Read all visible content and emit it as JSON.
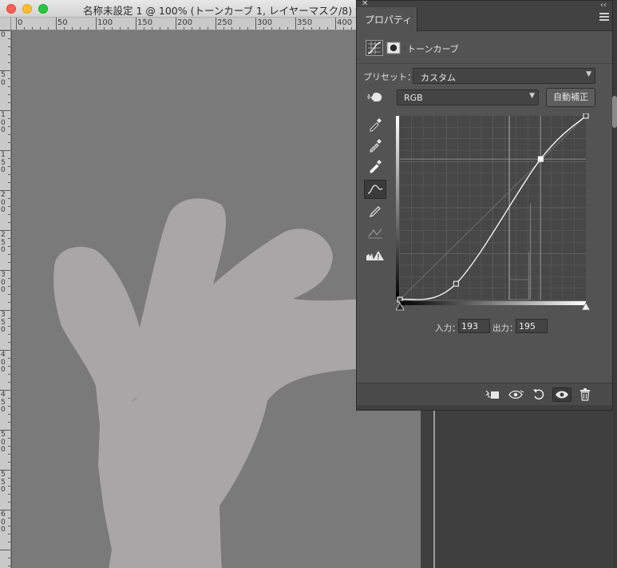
{
  "document": {
    "title": "名称未設定 1 @ 100% (トーンカーブ 1, レイヤーマスク/8) *",
    "ruler_h_labels": [
      "0",
      "50",
      "100",
      "150",
      "200",
      "250",
      "300",
      "350",
      "400"
    ],
    "ruler_v_labels": [
      "0",
      "5\n0",
      "1\n0\n0",
      "1\n5\n0",
      "2\n0\n0",
      "2\n5\n0",
      "3\n0\n0",
      "3\n5\n0",
      "4\n0\n0",
      "4\n5\n0",
      "5\n0\n0",
      "5\n5\n0",
      "6\n0\n0"
    ],
    "colors": {
      "canvas": "#7a7a7a",
      "mask_shape": "#a8a6a6"
    }
  },
  "panel": {
    "tab": "プロパティ",
    "close_icon": "close-icon",
    "collapse_label": "‹‹",
    "adjustment_name": "トーンカーブ",
    "preset_label": "プリセット：",
    "preset_value": "カスタム",
    "channel_value": "RGB",
    "auto_button": "自動補正",
    "input_label": "入力：",
    "input_value": "193",
    "output_label": "出力：",
    "output_value": "195",
    "tools": [
      "eyedropper-black-icon",
      "eyedropper-gray-icon",
      "eyedropper-white-icon",
      "curve-point-icon",
      "pencil-icon",
      "smooth-curve-icon",
      "clipping-warning-icon"
    ],
    "bottom_icons": [
      "clip-to-layer-icon",
      "view-previous-icon",
      "reset-icon",
      "visibility-icon",
      "trash-icon"
    ]
  },
  "chart_data": {
    "type": "line",
    "xlim": [
      0,
      255
    ],
    "ylim": [
      0,
      255
    ],
    "grid": true,
    "curve_points": [
      [
        0,
        0
      ],
      [
        77,
        22
      ],
      [
        193,
        195
      ],
      [
        255,
        255
      ]
    ],
    "selected_point": [
      193,
      195
    ]
  }
}
